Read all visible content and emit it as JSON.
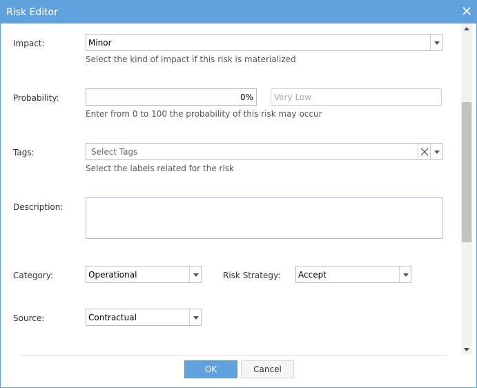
{
  "window": {
    "title": "Risk Editor",
    "close_icon": "close-icon"
  },
  "form": {
    "impact": {
      "label": "Impact:",
      "value": "Minor",
      "help": "Select the kind of impact if this risk is materialized"
    },
    "probability": {
      "label": "Probability:",
      "value": "0%",
      "level": "Very Low",
      "help": "Enter from 0 to 100 the probability of this risk may occur"
    },
    "tags": {
      "label": "Tags:",
      "placeholder": "Select Tags",
      "help": "Select the labels related for the risk"
    },
    "description": {
      "label": "Description:",
      "value": ""
    },
    "category": {
      "label": "Category:",
      "value": "Operational"
    },
    "risk_strategy": {
      "label": "Risk Strategy:",
      "value": "Accept"
    },
    "source": {
      "label": "Source:",
      "value": "Contractual"
    }
  },
  "footer": {
    "ok_label": "OK",
    "cancel_label": "Cancel"
  },
  "colors": {
    "accent": "#5fa2dd",
    "border": "#b5b8c8"
  }
}
